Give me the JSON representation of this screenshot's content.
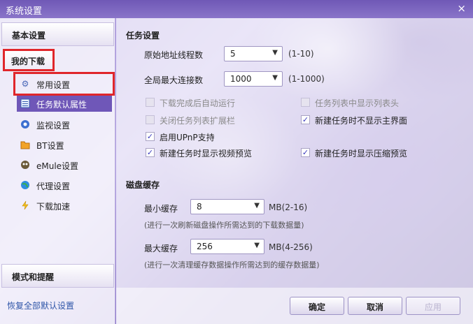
{
  "window": {
    "title": "系统设置",
    "close_glyph": "×"
  },
  "sidebar": {
    "basic": "基本设置",
    "my_download": "我的下载",
    "items": [
      {
        "label": "常用设置",
        "icon": "gear-icon"
      },
      {
        "label": "任务默认属性",
        "icon": "list-icon"
      },
      {
        "label": "监视设置",
        "icon": "eye-icon"
      },
      {
        "label": "BT设置",
        "icon": "folder-icon"
      },
      {
        "label": "eMule设置",
        "icon": "emule-icon"
      },
      {
        "label": "代理设置",
        "icon": "globe-icon"
      },
      {
        "label": "下载加速",
        "icon": "lightning-icon"
      }
    ],
    "mode": "模式和提醒",
    "restore": "恢复全部默认设置"
  },
  "task": {
    "section_title": "任务设置",
    "threads_label": "原始地址线程数",
    "threads_value": "5",
    "threads_range": "(1-10)",
    "max_conn_label": "全局最大连接数",
    "max_conn_value": "1000",
    "max_conn_range": "(1-1000)",
    "options": [
      {
        "label": "下载完成后自动运行",
        "checked": false,
        "enabled": false
      },
      {
        "label": "任务列表中显示列表头",
        "checked": false,
        "enabled": false
      },
      {
        "label": "关闭任务列表扩展栏",
        "checked": false,
        "enabled": false
      },
      {
        "label": "新建任务时不显示主界面",
        "checked": true,
        "enabled": true
      },
      {
        "label": "启用UPnP支持",
        "checked": true,
        "enabled": true
      },
      {
        "label": "新建任务时显示视频预览",
        "checked": true,
        "enabled": true
      },
      {
        "label": "新建任务时显示压缩预览",
        "checked": true,
        "enabled": true
      }
    ]
  },
  "cache": {
    "section_title": "磁盘缓存",
    "min_label": "最小缓存",
    "min_value": "8",
    "min_range": "MB(2-16)",
    "min_note": "(进行一次刷新磁盘操作所需达到的下载数据量)",
    "max_label": "最大缓存",
    "max_value": "256",
    "max_range": "MB(4-256)",
    "max_note": "(进行一次清理缓存数据操作所需达到的缓存数据量)"
  },
  "buttons": {
    "ok": "确定",
    "cancel": "取消",
    "apply": "应用"
  },
  "check_glyph": "✓",
  "arrow_glyph": "▼"
}
